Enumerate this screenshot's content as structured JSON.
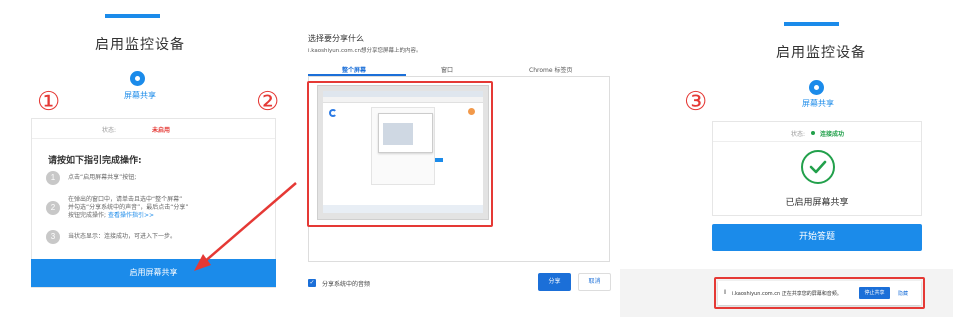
{
  "colors": {
    "primary": "#1b8bea",
    "annotation_red": "#e53935",
    "success": "#22a04b"
  },
  "panel1": {
    "step_number": "①",
    "title": "启用监控设备",
    "step_label": "屏幕共享",
    "status_key": "状态:",
    "status_value": "未启用",
    "guide_title": "请按如下指引完成操作:",
    "steps": [
      {
        "num": "1",
        "lines": [
          "点击“启用屏幕共享”按钮;"
        ]
      },
      {
        "num": "2",
        "lines": [
          "在弹出的窗口中，请单击且选中“整个屏幕”",
          "并勾选“分享系统中的声音”，最后点击“分享”"
        ],
        "prefix": "按钮完成操作; ",
        "link": "查看操作指引>>"
      },
      {
        "num": "3",
        "lines": [
          "当状态显示：连接成功，可进入下一步。"
        ]
      }
    ],
    "enable_button": "启用屏幕共享"
  },
  "panel2": {
    "step_number": "②",
    "title": "选择要分享什么",
    "subtitle": "i.kaoshiyun.com.cn想分享您屏幕上的内容。",
    "tabs": [
      "整个屏幕",
      "窗口",
      "Chrome 标签页"
    ],
    "share_audio_label": "分享系统中的音频",
    "share_button": "分享",
    "cancel_button": "取消"
  },
  "panel3": {
    "step_number": "③",
    "title": "启用监控设备",
    "step_label": "屏幕共享",
    "status_key": "状态:",
    "status_value": "连接成功",
    "shared_text": "已启用屏幕共享",
    "start_button": "开始答题",
    "notify_text": "i.kaoshiyun.com.cn 正在共享您的屏幕和音频。",
    "stop_button": "停止共享",
    "hide_link": "隐藏"
  }
}
